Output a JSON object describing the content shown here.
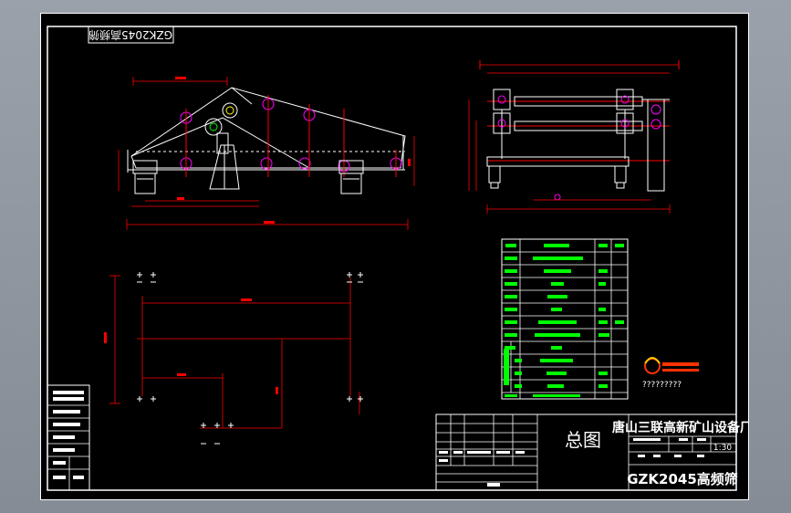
{
  "drawing": {
    "stamp_text": "GZK2045高频筛",
    "title_center": "总图",
    "company": "唐山三联高新矿山设备厂",
    "product_name": "GZK2045高频筛",
    "scale": "1:30",
    "logo_caption": "?????????",
    "param_table_rows": 12
  },
  "colors": {
    "background": "#000000",
    "lines": "#ffffff",
    "dimensions": "#ff0000",
    "parts": "#ff00ff",
    "table_text": "#00ff00",
    "accent": "#ffff00",
    "frame": "#888c94"
  }
}
